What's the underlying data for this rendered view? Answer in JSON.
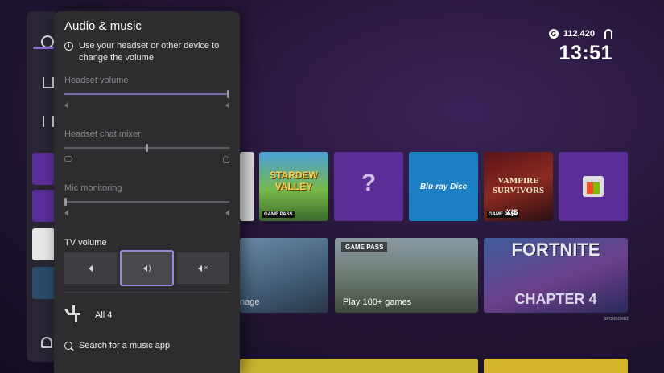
{
  "status": {
    "gamerscore_badge": "G",
    "gamerscore": "112,420",
    "time": "13:51"
  },
  "panel": {
    "title": "Audio & music",
    "info_text": "Use your headset or other device to change the volume",
    "headset_volume": {
      "label": "Headset volume",
      "level": 1.0
    },
    "chat_mixer": {
      "label": "Headset chat mixer",
      "level": 0.5
    },
    "mic_monitoring": {
      "label": "Mic monitoring",
      "level": 0.0
    },
    "tv_volume": {
      "label": "TV volume",
      "buttons": [
        {
          "name": "volume-down",
          "icon": "speaker-low-icon"
        },
        {
          "name": "volume-up",
          "icon": "speaker-high-icon",
          "active": true
        },
        {
          "name": "mute",
          "icon": "speaker-mute-icon"
        }
      ]
    },
    "app": {
      "name": "All 4",
      "icon": "channel-4-logo"
    },
    "search_label": "Search for a music app"
  },
  "tiles": {
    "stardew": "STARDEW VALLEY",
    "game_pass_mini": "GAME PASS",
    "help": "?",
    "bluray": "Blu-ray Disc",
    "vampire": "VAMPIRE SURVIVORS",
    "xs": "X|S",
    "gp_badge": "GAME PASS",
    "play": "Play 100+ games",
    "manage": "nage",
    "fortnite": "FORTNITE",
    "chapter": "CHAPTER 4",
    "sponsored": "SPONSORED"
  },
  "colors": {
    "accent": "#9b86e2",
    "panel_bg": "#2d2c2e",
    "tile_purple": "#5b2d98",
    "bluray_blue": "#1c7fc4"
  }
}
